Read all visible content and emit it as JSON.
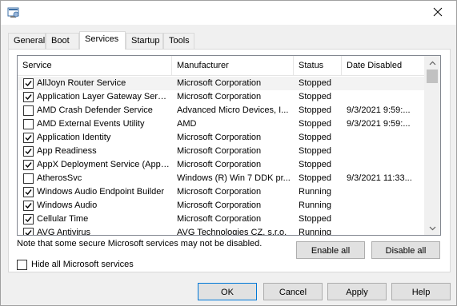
{
  "tabs": [
    {
      "label": "General"
    },
    {
      "label": "Boot"
    },
    {
      "label": "Services"
    },
    {
      "label": "Startup"
    },
    {
      "label": "Tools"
    }
  ],
  "active_tab": "Services",
  "columns": {
    "service": "Service",
    "manufacturer": "Manufacturer",
    "status": "Status",
    "date_disabled": "Date Disabled"
  },
  "services": [
    {
      "checked": true,
      "service": "AllJoyn Router Service",
      "manufacturer": "Microsoft Corporation",
      "status": "Stopped",
      "date_disabled": ""
    },
    {
      "checked": true,
      "service": "Application Layer Gateway Service",
      "manufacturer": "Microsoft Corporation",
      "status": "Stopped",
      "date_disabled": ""
    },
    {
      "checked": false,
      "service": "AMD Crash Defender Service",
      "manufacturer": "Advanced Micro Devices, I...",
      "status": "Stopped",
      "date_disabled": "9/3/2021 9:59:..."
    },
    {
      "checked": false,
      "service": "AMD External Events Utility",
      "manufacturer": "AMD",
      "status": "Stopped",
      "date_disabled": "9/3/2021 9:59:..."
    },
    {
      "checked": true,
      "service": "Application Identity",
      "manufacturer": "Microsoft Corporation",
      "status": "Stopped",
      "date_disabled": ""
    },
    {
      "checked": true,
      "service": "App Readiness",
      "manufacturer": "Microsoft Corporation",
      "status": "Stopped",
      "date_disabled": ""
    },
    {
      "checked": true,
      "service": "AppX Deployment Service (AppX...",
      "manufacturer": "Microsoft Corporation",
      "status": "Stopped",
      "date_disabled": ""
    },
    {
      "checked": false,
      "service": "AtherosSvc",
      "manufacturer": "Windows (R) Win 7 DDK pr...",
      "status": "Stopped",
      "date_disabled": "9/3/2021 11:33..."
    },
    {
      "checked": true,
      "service": "Windows Audio Endpoint Builder",
      "manufacturer": "Microsoft Corporation",
      "status": "Running",
      "date_disabled": ""
    },
    {
      "checked": true,
      "service": "Windows Audio",
      "manufacturer": "Microsoft Corporation",
      "status": "Running",
      "date_disabled": ""
    },
    {
      "checked": true,
      "service": "Cellular Time",
      "manufacturer": "Microsoft Corporation",
      "status": "Stopped",
      "date_disabled": ""
    },
    {
      "checked": true,
      "service": "AVG Antivirus",
      "manufacturer": "AVG Technologies CZ, s.r.o.",
      "status": "Running",
      "date_disabled": ""
    }
  ],
  "note": "Note that some secure Microsoft services may not be disabled.",
  "enable_all": "Enable all",
  "disable_all": "Disable all",
  "hide_ms_label": "Hide all Microsoft services",
  "hide_ms_checked": false,
  "buttons": {
    "ok": "OK",
    "cancel": "Cancel",
    "apply": "Apply",
    "help": "Help"
  }
}
